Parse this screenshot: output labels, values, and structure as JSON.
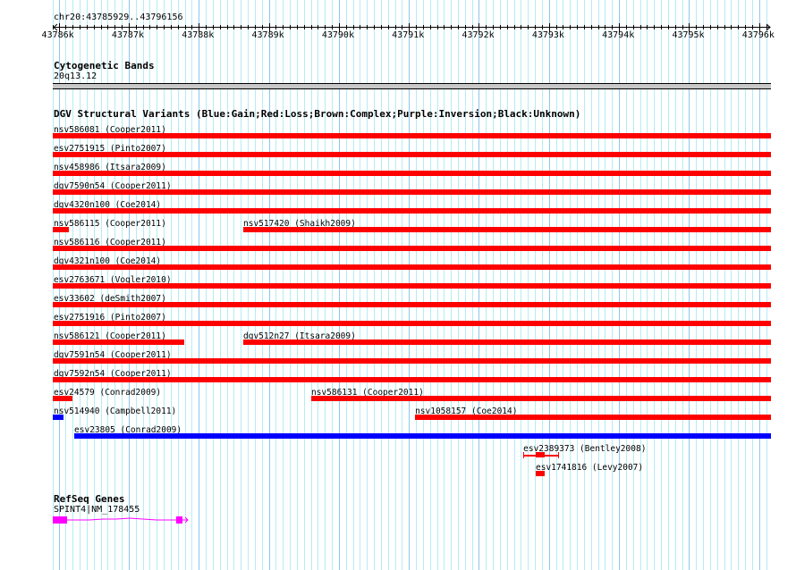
{
  "view": {
    "region": "chr20:43785929..43796156",
    "start": 43785929,
    "end": 43796156
  },
  "ruler": {
    "ticks": [
      "43786k",
      "43787k",
      "43788k",
      "43789k",
      "43790k",
      "43791k",
      "43792k",
      "43793k",
      "43794k",
      "43795k",
      "43796k"
    ]
  },
  "cytoband": {
    "title": "Cytogenetic Bands",
    "band": "20q13.12"
  },
  "dgv": {
    "title": "DGV Structural Variants (Blue:Gain;Red:Loss;Brown:Complex;Purple:Inversion;Black:Unknown)",
    "colors": {
      "loss": "#ff0000",
      "gain": "#0000ff"
    },
    "rows": [
      [
        {
          "label": "nsv586081 (Cooper2011)",
          "start": 43785900,
          "end": 43796200,
          "type": "loss"
        }
      ],
      [
        {
          "label": "esv2751915 (Pinto2007)",
          "start": 43785900,
          "end": 43796200,
          "type": "loss"
        }
      ],
      [
        {
          "label": "nsv458986 (Itsara2009)",
          "start": 43785900,
          "end": 43796200,
          "type": "loss"
        }
      ],
      [
        {
          "label": "dgv7590n54 (Cooper2011)",
          "start": 43785900,
          "end": 43796200,
          "type": "loss"
        }
      ],
      [
        {
          "label": "dgv4320n100 (Coe2014)",
          "start": 43785900,
          "end": 43796200,
          "type": "loss"
        }
      ],
      [
        {
          "label": "nsv586115 (Cooper2011)",
          "start": 43785900,
          "end": 43786146,
          "type": "loss"
        },
        {
          "label": "nsv517420 (Shaikh2009)",
          "start": 43788636,
          "end": 43796200,
          "type": "loss"
        }
      ],
      [
        {
          "label": "nsv586116 (Cooper2011)",
          "start": 43785900,
          "end": 43796200,
          "type": "loss"
        }
      ],
      [
        {
          "label": "dgv4321n100 (Coe2014)",
          "start": 43785900,
          "end": 43796200,
          "type": "loss"
        }
      ],
      [
        {
          "label": "esv2763671 (Vogler2010)",
          "start": 43785900,
          "end": 43796200,
          "type": "loss"
        }
      ],
      [
        {
          "label": "esv33602 (deSmith2007)",
          "start": 43785900,
          "end": 43796200,
          "type": "loss"
        }
      ],
      [
        {
          "label": "esv2751916 (Pinto2007)",
          "start": 43785900,
          "end": 43796200,
          "type": "loss"
        }
      ],
      [
        {
          "label": "nsv586121 (Cooper2011)",
          "start": 43785900,
          "end": 43787793,
          "type": "loss"
        },
        {
          "label": "dgv512n27 (Itsara2009)",
          "start": 43788636,
          "end": 43796200,
          "type": "loss"
        }
      ],
      [
        {
          "label": "dgv7591n54 (Cooper2011)",
          "start": 43785900,
          "end": 43796200,
          "type": "loss"
        }
      ],
      [
        {
          "label": "dgv7592n54 (Cooper2011)",
          "start": 43785900,
          "end": 43796200,
          "type": "loss"
        }
      ],
      [
        {
          "label": "esv24579 (Conrad2009)",
          "start": 43785900,
          "end": 43786197,
          "type": "loss"
        },
        {
          "label": "nsv586131 (Cooper2011)",
          "start": 43789606,
          "end": 43796200,
          "type": "loss"
        }
      ],
      [
        {
          "label": "nsv514940 (Campbell2011)",
          "start": 43785900,
          "end": 43786069,
          "type": "gain"
        },
        {
          "label": "nsv1058157 (Coe2014)",
          "start": 43791088,
          "end": 43796200,
          "type": "loss"
        }
      ],
      [
        {
          "label": "esv23805 (Conrad2009)",
          "start": 43786223,
          "end": 43796200,
          "type": "gain"
        }
      ],
      [
        {
          "label": "esv2389373 (Bentley2008)",
          "start": 43792634,
          "end": 43793145,
          "innerStart": 43792811,
          "innerEnd": 43792939,
          "type": "loss"
        }
      ],
      [
        {
          "label": "esv1741816 (Levy2007)",
          "start": 43792811,
          "end": 43792939,
          "type": "loss"
        }
      ]
    ]
  },
  "refseq": {
    "title": "RefSeq Genes",
    "gene": "SPINT4|NM_178455",
    "color": "#ff00ff"
  }
}
